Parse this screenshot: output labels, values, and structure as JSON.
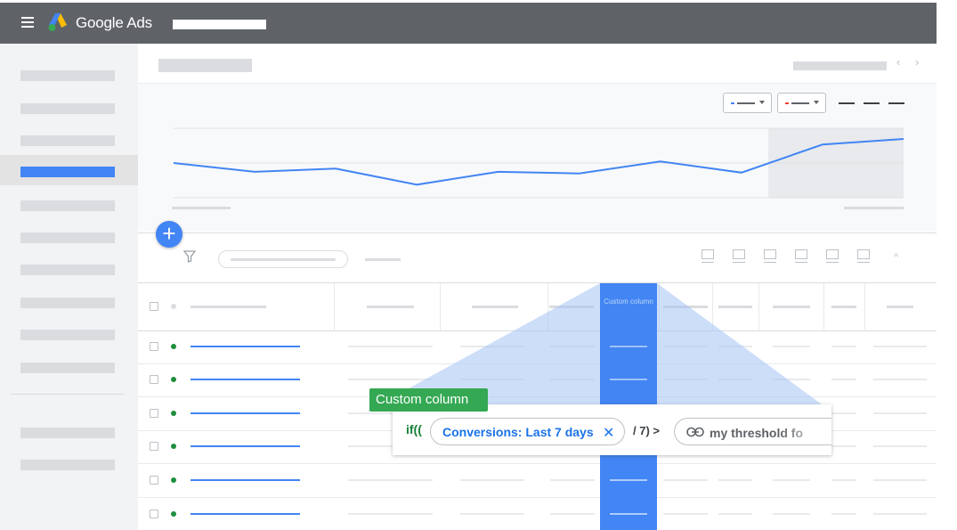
{
  "header": {
    "brand": "Google Ads",
    "menu_icon": "hamburger-menu-icon",
    "logo_icon": "google-ads-logo-icon",
    "bg_color": "#5f6368"
  },
  "sidebar": {
    "active_index": 3,
    "active_color": "#4285f4"
  },
  "toolbar": {
    "prev_arrow": "‹",
    "next_arrow": "›",
    "filter_icon": "filter-icon",
    "collapse_glyph": "^",
    "add_glyph": "+"
  },
  "chart_data": {
    "type": "line",
    "series": [
      {
        "values": [
          5,
          3.9,
          4.3,
          2.3,
          3.9,
          3.7,
          5.2,
          3.8,
          7.3,
          8
        ]
      }
    ],
    "color": "#4285f4",
    "grid": true
  },
  "table": {
    "custom_column_header": "Custom column",
    "custom_column_color": "#4285f4",
    "row_status_color": "#1e8e3e",
    "rows": 6
  },
  "editor": {
    "tag_label": "Custom column",
    "tag_color": "#34a853",
    "func_prefix": "if((",
    "metric_chip": "Conversions: Last 7 days",
    "chip_close_glyph": "✕",
    "operator_text": "/ 7) >",
    "threshold_text": "my threshold fo",
    "link_icon": "link-icon"
  }
}
